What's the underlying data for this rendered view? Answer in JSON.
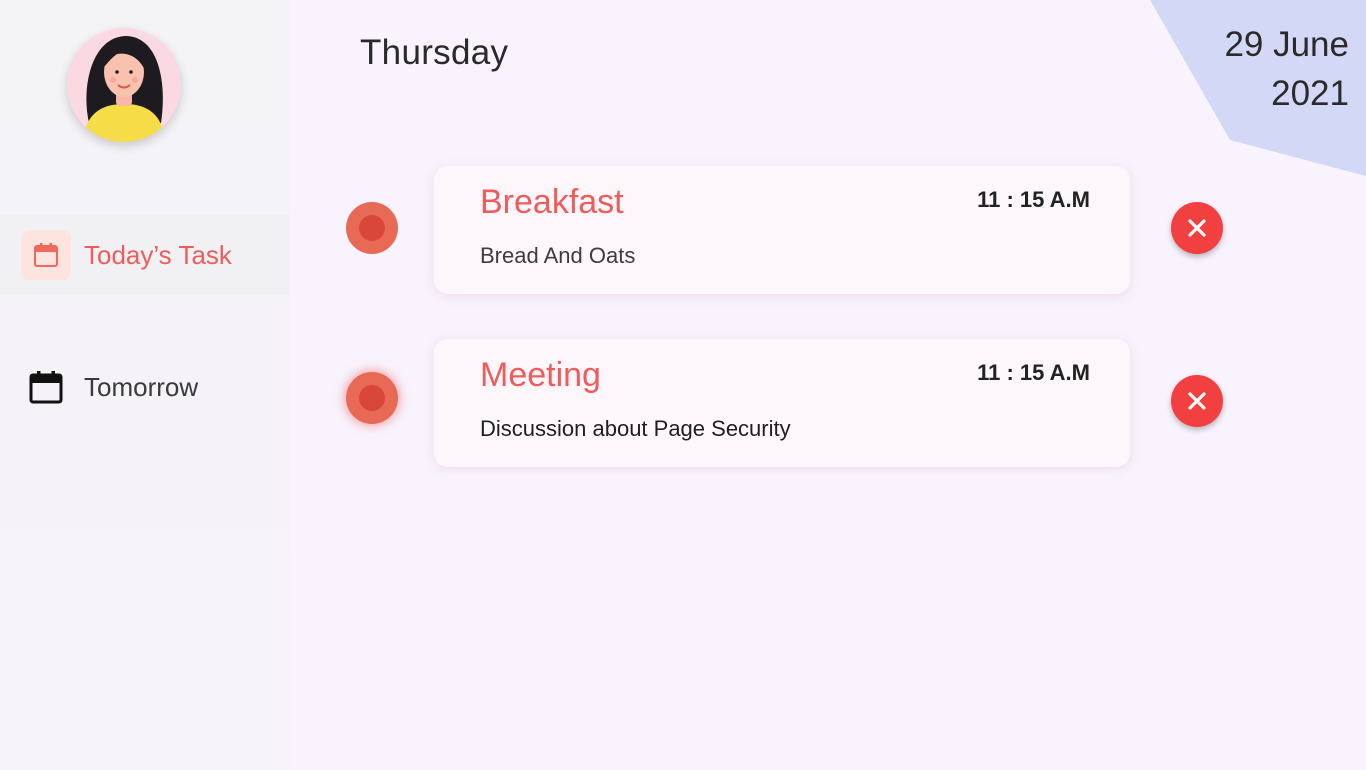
{
  "sidebar": {
    "avatar": {
      "icon": "user-avatar-icon"
    },
    "items": [
      {
        "label": "Today’s Task",
        "icon": "calendar-icon",
        "active": true
      },
      {
        "label": "Tomorrow",
        "icon": "calendar-icon",
        "active": false
      }
    ]
  },
  "header": {
    "day": "Thursday",
    "date_line1": "29 June",
    "date_line2": "2021"
  },
  "tasks": [
    {
      "title": "Breakfast",
      "time": "11 : 15 A.M",
      "description": "Bread And Oats"
    },
    {
      "title": "Meeting",
      "time": "11 : 15 A.M",
      "description": "Discussion about Page Security"
    }
  ],
  "colors": {
    "accent": "#ef5c5c",
    "delete": "#f23f3f",
    "status_dot": "#e86a55",
    "corner": "#d3d8f7",
    "background": "#f8f3fd"
  }
}
